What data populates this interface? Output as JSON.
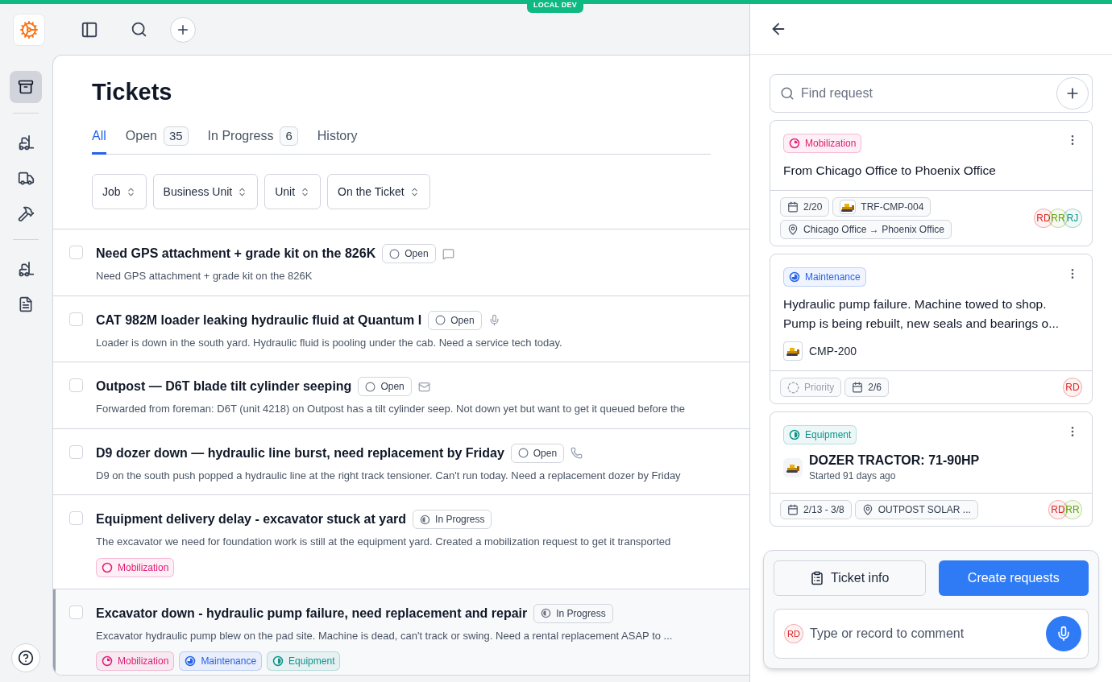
{
  "env_badge": "LOCAL DEV",
  "nav": [
    {
      "kind": "stack",
      "selected": true
    },
    {
      "kind": "loader",
      "selected": false
    },
    {
      "kind": "truck",
      "selected": false
    },
    {
      "kind": "hammer",
      "selected": false
    },
    {
      "kind": "loader",
      "selected": false
    },
    {
      "kind": "document",
      "selected": false
    }
  ],
  "page": {
    "title": "Tickets"
  },
  "tabs": [
    {
      "label": "All",
      "selected": true
    },
    {
      "label": "Open",
      "count": "35",
      "selected": false
    },
    {
      "label": "In Progress",
      "count": "6",
      "selected": false
    },
    {
      "label": "History",
      "selected": false
    }
  ],
  "filters": [
    "Job",
    "Business Unit",
    "Unit",
    "On the Ticket"
  ],
  "tickets": [
    {
      "title": "Need GPS attachment + grade kit on the 826K",
      "status": {
        "kind": "open",
        "label": "Open"
      },
      "channel": {
        "kind": "chat"
      },
      "description": "Need GPS attachment + grade kit on the 826K",
      "checked": false,
      "selected": false
    },
    {
      "title": "CAT 982M loader leaking hydraulic fluid at Quantum I",
      "status": {
        "kind": "open",
        "label": "Open"
      },
      "channel": {
        "kind": "voice"
      },
      "description": "Loader is down in the south yard. Hydraulic fluid is pooling under the cab. Need a service tech today.",
      "checked": false,
      "selected": false
    },
    {
      "title": "Outpost — D6T blade tilt cylinder seeping",
      "status": {
        "kind": "open",
        "label": "Open"
      },
      "channel": {
        "kind": "email"
      },
      "description": "Forwarded from foreman: D6T (unit 4218) on Outpost has a tilt cylinder seep. Not down yet but want to get it queued before the",
      "checked": false,
      "selected": false
    },
    {
      "title": "D9 dozer down — hydraulic line burst, need replacement by Friday",
      "status": {
        "kind": "open",
        "label": "Open"
      },
      "channel": {
        "kind": "phone"
      },
      "description": "D9 on the south push popped a hydraulic line at the right track tensioner. Can't run today. Need a replacement dozer by Friday",
      "checked": false,
      "selected": false
    },
    {
      "title": "Equipment delivery delay - excavator stuck at yard",
      "status": {
        "kind": "in_progress",
        "label": "In Progress"
      },
      "description": "The excavator we need for foundation work is still at the equipment yard. Created a mobilization request to get it transported",
      "tags": [
        {
          "label": "Mobilization",
          "kind": "ring",
          "color": "#e11d74"
        }
      ],
      "checked": false,
      "selected": false
    },
    {
      "title": "Excavator down - hydraulic pump failure, need replacement and repair",
      "status": {
        "kind": "in_progress",
        "label": "In Progress"
      },
      "description": "Excavator hydraulic pump blew on the pad site. Machine is dead, can't track or swing. Need a rental replacement ASAP to ...",
      "tags": [
        {
          "label": "Mobilization",
          "kind": "clock",
          "color": "#e11d74"
        },
        {
          "label": "Maintenance",
          "kind": "pie",
          "color": "#2563eb"
        },
        {
          "label": "Equipment",
          "kind": "half",
          "color": "#0d9488"
        }
      ],
      "checked": false,
      "selected": true
    }
  ],
  "panel": {
    "search": {
      "placeholder": "Find request"
    },
    "requests": [
      {
        "tag": {
          "label": "Mobilization",
          "kind": "clock",
          "color": "#e11d74"
        },
        "title": "From Chicago Office to Phoenix Office",
        "chips": [
          {
            "kind": "date",
            "label": "2/20"
          },
          {
            "kind": "unit",
            "label": "TRF-CMP-004"
          },
          {
            "kind": "route",
            "label": "Chicago Office → Phoenix Office"
          }
        ],
        "assignees": [
          {
            "initials": "RD",
            "color": "#dc2626"
          },
          {
            "initials": "RR",
            "color": "#65a30d"
          },
          {
            "initials": "RJ",
            "color": "#0d9488"
          }
        ]
      },
      {
        "tag": {
          "label": "Maintenance",
          "kind": "pie",
          "color": "#2563eb"
        },
        "title": "Hydraulic pump failure. Machine towed to shop. Pump is being rebuilt, new seals and bearings o...",
        "unit": "CMP-200",
        "chips": [
          {
            "kind": "priority",
            "label": "Priority"
          },
          {
            "kind": "date",
            "label": "2/6"
          }
        ],
        "assignees": [
          {
            "initials": "RD",
            "color": "#dc2626"
          }
        ]
      },
      {
        "tag": {
          "label": "Equipment",
          "kind": "half",
          "color": "#0d9488"
        },
        "equipment": {
          "name": "DOZER TRACTOR: 71-90HP",
          "started": "Started 91 days ago"
        },
        "chips": [
          {
            "kind": "date",
            "label": "2/13 - 3/8"
          },
          {
            "kind": "location",
            "label": "OUTPOST SOLAR ..."
          }
        ],
        "assignees": [
          {
            "initials": "RD",
            "color": "#dc2626"
          },
          {
            "initials": "RR",
            "color": "#65a30d"
          }
        ]
      }
    ],
    "actions": [
      {
        "label": "Ticket info",
        "kind": "secondary"
      },
      {
        "label": "Create requests",
        "kind": "primary"
      }
    ],
    "comment": {
      "avatar": {
        "initials": "RD",
        "color": "#dc2626"
      },
      "placeholder": "Type or record to comment"
    }
  }
}
